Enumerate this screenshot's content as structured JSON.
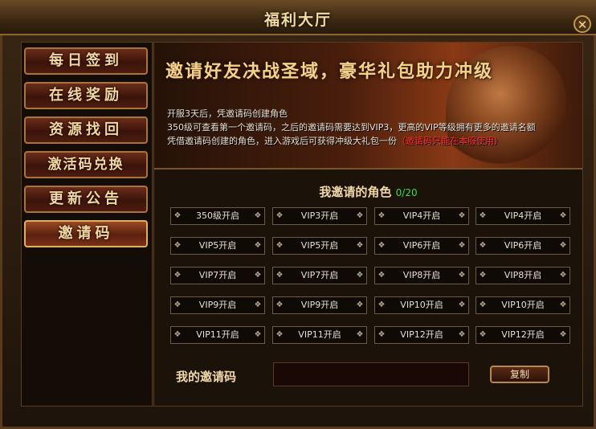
{
  "window": {
    "title": "福利大厅",
    "close_symbol": "✕"
  },
  "sidebar": {
    "items": [
      {
        "label": "每日签到"
      },
      {
        "label": "在线奖励"
      },
      {
        "label": "资源找回"
      },
      {
        "label": "激活码兑换"
      },
      {
        "label": "更新公告"
      },
      {
        "label": "邀请码",
        "active": true
      }
    ]
  },
  "banner": {
    "headline": "邀请好友决战圣域，豪华礼包助力冲级",
    "lines": [
      "开服3天后，凭邀请码创建角色",
      "350级可查看第一个邀请码，之后的邀请码需要达到VIP3，更高的VIP等级拥有更多的邀请名额",
      "凭借邀请码创建的角色，进入游戏后可获得冲级大礼包一份"
    ],
    "warning": "（邀请码只能在本服使用）"
  },
  "invites": {
    "title": "我邀请的角色",
    "count": "0/20",
    "slots": [
      "350级开启",
      "VIP3开启",
      "VIP4开启",
      "VIP4开启",
      "VIP5开启",
      "VIP5开启",
      "VIP6开启",
      "VIP6开启",
      "VIP7开启",
      "VIP7开启",
      "VIP8开启",
      "VIP8开启",
      "VIP9开启",
      "VIP9开启",
      "VIP10开启",
      "VIP10开启",
      "VIP11开启",
      "VIP11开启",
      "VIP12开启",
      "VIP12开启"
    ]
  },
  "my_code": {
    "label": "我的邀请码",
    "value": "",
    "copy_label": "复制"
  }
}
